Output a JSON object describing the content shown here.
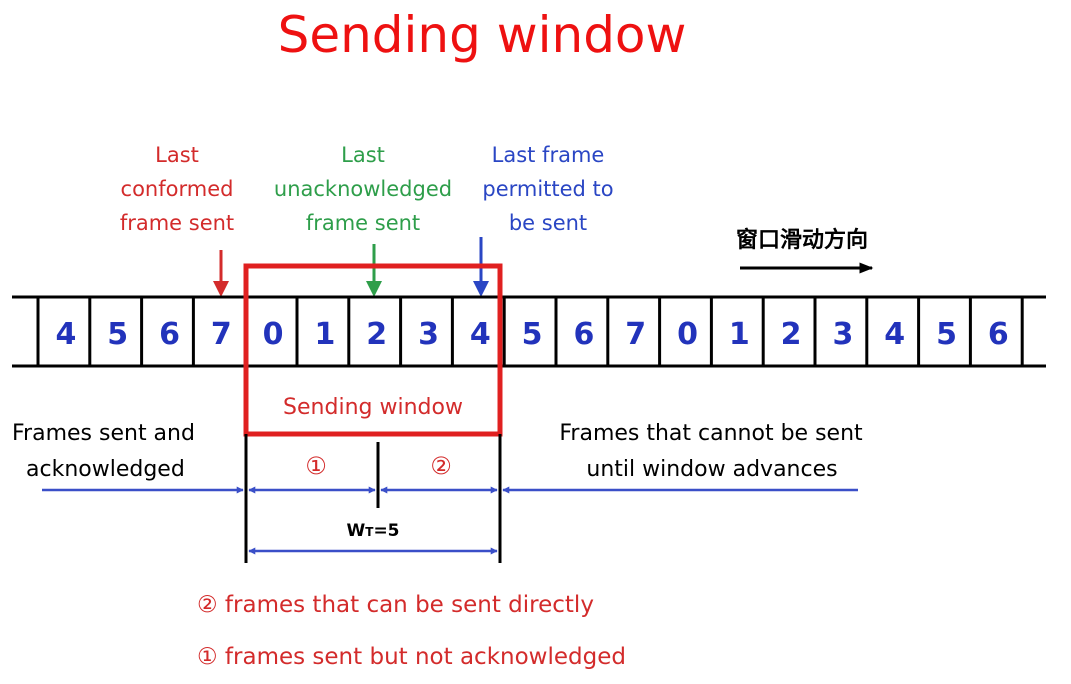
{
  "title": "Sending window",
  "pointers": {
    "last_confirmed": {
      "lines": [
        "Last",
        "conformed",
        "frame sent"
      ],
      "color": "#d32b2b"
    },
    "last_unacknowledged": {
      "lines": [
        "Last",
        "unacknowledged",
        "frame sent"
      ],
      "color": "#2e9e4a"
    },
    "last_permitted": {
      "lines": [
        "Last frame",
        "permitted to",
        "be sent"
      ],
      "color": "#2a46c4"
    }
  },
  "sliding_direction_label": "窗口滑动方向",
  "frames": [
    "4",
    "5",
    "6",
    "7",
    "0",
    "1",
    "2",
    "3",
    "4",
    "5",
    "6",
    "7",
    "0",
    "1",
    "2",
    "3",
    "4",
    "5",
    "6"
  ],
  "window": {
    "label": "Sending window",
    "start_index": 4,
    "size": 5,
    "color": "#e02020"
  },
  "regions": {
    "left": {
      "lines": [
        "Frames sent and",
        "acknowledged"
      ]
    },
    "right": {
      "lines": [
        "Frames that cannot be sent",
        "until window advances"
      ]
    }
  },
  "segment_marks": {
    "first": "①",
    "second": "②"
  },
  "window_size_label": {
    "main": "W",
    "sub": "T",
    "value": "=5"
  },
  "legend": [
    {
      "text": "② frames that can be sent directly",
      "color": "#d32b2b"
    },
    {
      "text": "① frames sent but not acknowledged",
      "color": "#d32b2b"
    }
  ],
  "colors": {
    "frame_digit": "#2233bb",
    "arrow_blue": "#3a4fc8",
    "title": "#ee1111"
  }
}
